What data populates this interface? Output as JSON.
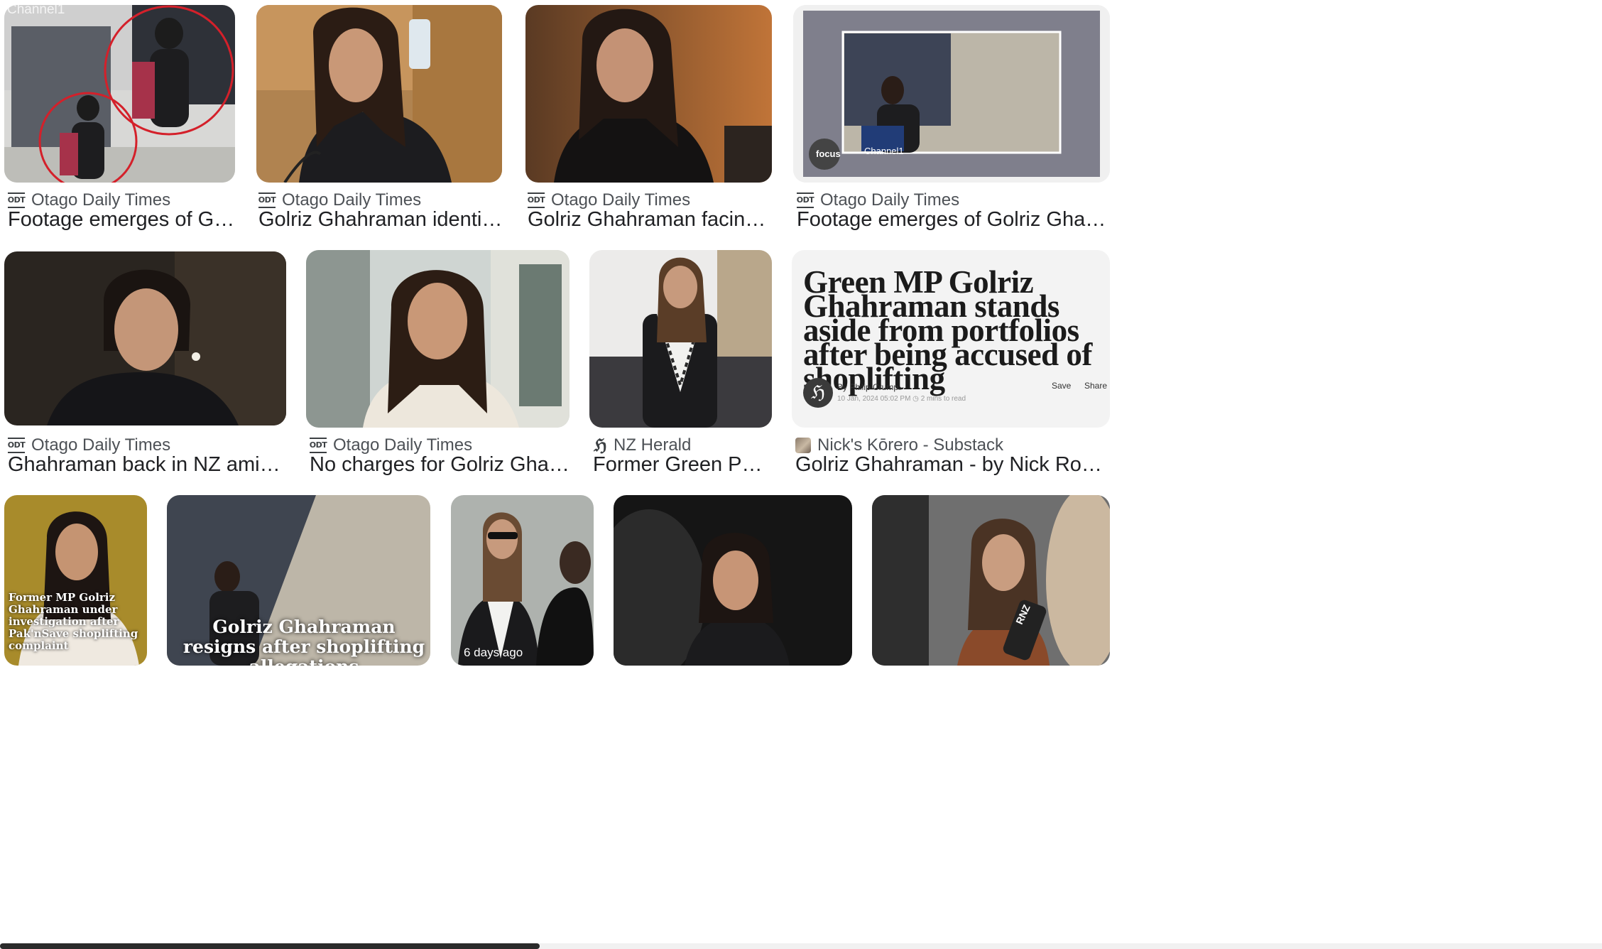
{
  "results": [
    {
      "source": "Otago Daily Times",
      "title": "Footage emerges of Golriz Ghah...",
      "favicon": "odt",
      "thumb_label": "Channel1"
    },
    {
      "source": "Otago Daily Times",
      "title": "Golriz Ghahraman identified in seco...",
      "favicon": "odt"
    },
    {
      "source": "Otago Daily Times",
      "title": "Golriz Ghahraman facing third ...",
      "favicon": "odt"
    },
    {
      "source": "Otago Daily Times",
      "title": "Footage emerges of Golriz Ghahraman's ...",
      "favicon": "odt",
      "thumb_label": "focus",
      "thumb_label2": "Channel1"
    },
    {
      "source": "Otago Daily Times",
      "title": "Ghahraman back in NZ amid shoplifting ...",
      "favicon": "odt"
    },
    {
      "source": "Otago Daily Times",
      "title": "No charges for Golriz Ghahraman afte...",
      "favicon": "odt"
    },
    {
      "source": "NZ Herald",
      "title": "Former Green Party MP ...",
      "favicon": "herald"
    },
    {
      "source": "Nick's Kōrero - Substack",
      "title": "Golriz Ghahraman - by Nick Rockel ...",
      "favicon": "substack",
      "headline": "Green MP Golriz Ghahraman stands aside from portfolios after being accused of shoplifting",
      "byline": "By Philip Crump",
      "dateline": "10 Jan, 2024 05:02 PM  ◷ 2 mins to read",
      "save": "Save",
      "share": "Share"
    },
    {
      "overlay": "Former MP Golriz Ghahraman under investigation after Pak'nSave shoplifting complaint"
    },
    {
      "overlay": "Golriz Ghahraman resigns after shoplifting allegations"
    },
    {
      "overlay": "6 days ago"
    },
    {},
    {
      "overlay": "RNZ"
    }
  ],
  "colors": {
    "source_text": "#4d5156",
    "title_text": "#202124",
    "accent_red": "#d4202a"
  }
}
